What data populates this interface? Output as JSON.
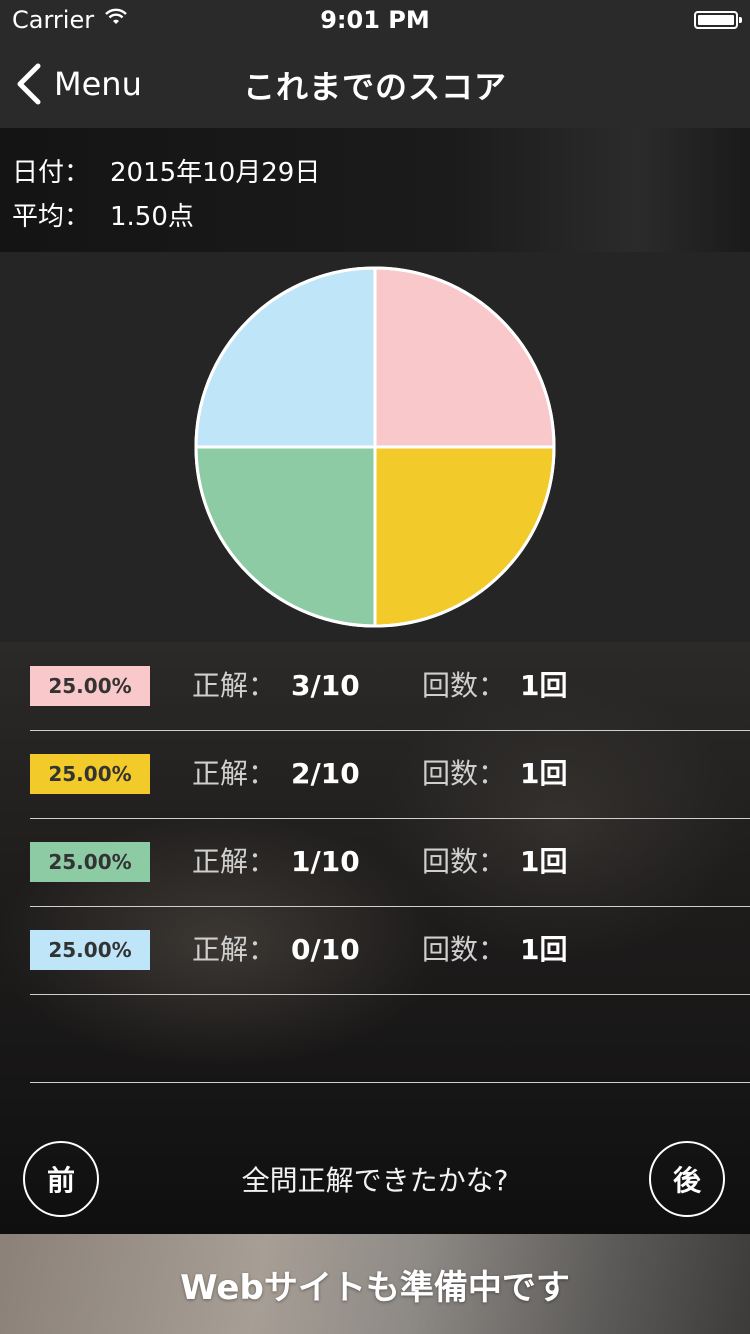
{
  "status_bar": {
    "carrier": "Carrier",
    "time": "9:01 PM"
  },
  "nav": {
    "back_label": "Menu",
    "title": "これまでのスコア"
  },
  "info": {
    "date_label": "日付：",
    "date_value": "2015年10月29日",
    "avg_label": "平均：",
    "avg_value": "1.50点"
  },
  "chart_data": {
    "type": "pie",
    "values": [
      25,
      25,
      25,
      25
    ],
    "colors": [
      "#f8c8cb",
      "#f2cb2a",
      "#8dcba4",
      "#bfe6f8"
    ],
    "labels": [
      "25.00%",
      "25.00%",
      "25.00%",
      "25.00%"
    ]
  },
  "rows": [
    {
      "percent": "25.00%",
      "color": "#f8c8cb",
      "correct_label": "正解：",
      "correct_value": "3/10",
      "count_label": "回数：",
      "count_value": "1回"
    },
    {
      "percent": "25.00%",
      "color": "#f2cb2a",
      "correct_label": "正解：",
      "correct_value": "2/10",
      "count_label": "回数：",
      "count_value": "1回"
    },
    {
      "percent": "25.00%",
      "color": "#8dcba4",
      "correct_label": "正解：",
      "correct_value": "1/10",
      "count_label": "回数：",
      "count_value": "1回"
    },
    {
      "percent": "25.00%",
      "color": "#bfe6f8",
      "correct_label": "正解：",
      "correct_value": "0/10",
      "count_label": "回数：",
      "count_value": "1回"
    }
  ],
  "footer": {
    "prev_label": "前",
    "hint": "全問正解できたかな?",
    "next_label": "後"
  },
  "banner": {
    "text": "Webサイトも準備中です"
  },
  "icons": {
    "back": "chevron-left-icon",
    "wifi": "wifi-icon",
    "battery": "battery-icon"
  }
}
